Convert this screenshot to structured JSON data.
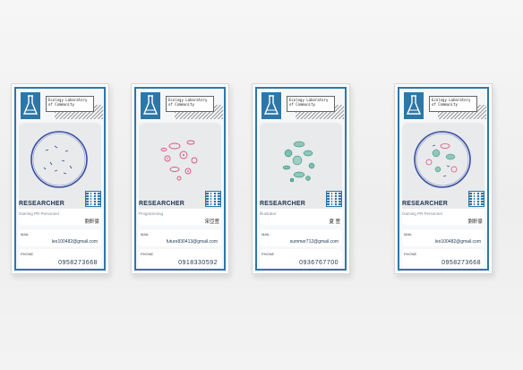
{
  "cards": [
    {
      "lab_name": "Ecology Laboratory of Community",
      "role": "RESEARCHER",
      "subtitle": "Gaming PR Personnel",
      "name": "劉軒豪",
      "mail_label": "MAIL",
      "email": "leo100482@gmail.com",
      "phone_label": "PHONE",
      "phone": "0958273668",
      "art_color": "#3a4fa0",
      "art_name": "petri-dish-art"
    },
    {
      "lab_name": "Ecology Laboratory of Community",
      "role": "RESEARCHER",
      "subtitle": "Programming",
      "name": "宋亞萱",
      "mail_label": "MAIL",
      "email": "future830413@gmail.com",
      "phone_label": "PHONE",
      "phone": "0918330592",
      "art_color": "#d9557a",
      "art_name": "microbe-art"
    },
    {
      "lab_name": "Ecology Laboratory of Community",
      "role": "RESEARCHER",
      "subtitle": "Illustrator",
      "name": "夏 萱",
      "mail_label": "MAIL",
      "email": "summer712@gmail.com",
      "phone_label": "PHONE",
      "phone": "0936767700",
      "art_color": "#2fa58a",
      "art_name": "microbe-art"
    },
    {
      "lab_name": "Ecology Laboratory of Community",
      "role": "RESEARCHER",
      "subtitle": "Gaming PR Personnel",
      "name": "劉軒豪",
      "mail_label": "MAIL",
      "email": "leo100482@gmail.com",
      "phone_label": "PHONE",
      "phone": "0958273668",
      "art_color": "#3a4fa0",
      "art_name": "mixed-petri-art"
    }
  ],
  "colors": {
    "frame": "#2d77a8",
    "text_dark": "#1f3550",
    "background": "#f1f1f1"
  }
}
